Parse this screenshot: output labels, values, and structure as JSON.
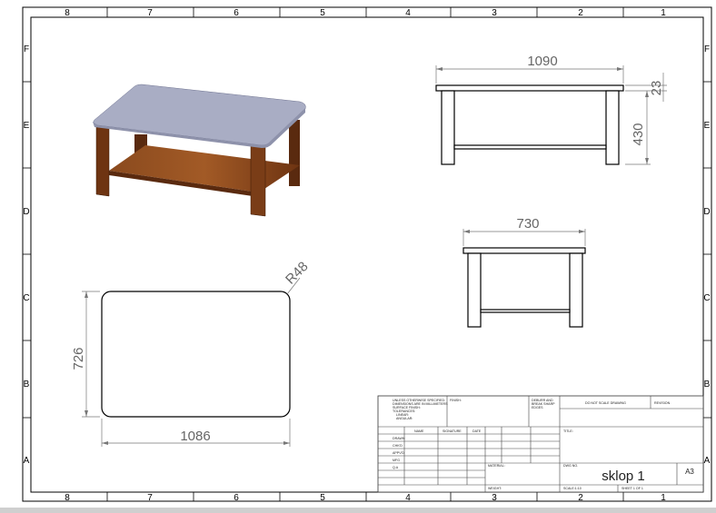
{
  "zones": {
    "columns": [
      "8",
      "7",
      "6",
      "5",
      "4",
      "3",
      "2",
      "1"
    ],
    "rows": [
      "F",
      "E",
      "D",
      "C",
      "B",
      "A"
    ]
  },
  "dimensions": {
    "front_length": "1090",
    "front_top_thickness": "23",
    "front_height": "430",
    "side_width": "730",
    "top_radius": "R48",
    "top_length": "1086",
    "top_width": "726"
  },
  "title_block": {
    "general_tolerances": [
      "UNLESS OTHERWISE SPECIFIED:",
      "DIMENSIONS ARE IN MILLIMETERS",
      "SURFACE FINISH:",
      "TOLERANCES:",
      "LINEAR:",
      "ANGULAR:"
    ],
    "finish_label": "FINISH:",
    "deburr_label": [
      "DEBURR AND",
      "BREAK SHARP",
      "EDGES"
    ],
    "do_not_scale": "DO NOT SCALE DRAWING",
    "revision_label": "REVISION",
    "col_headers": [
      "NAME",
      "SIGNATURE",
      "DATE"
    ],
    "rows": [
      "DRAWN",
      "CHK'D",
      "APPV'D",
      "MFG",
      "Q.A"
    ],
    "title_label": "TITLE:",
    "material_label": "MATERIAL:",
    "dwg_no_label": "DWG NO.",
    "dwg_no": "sklop 1",
    "sheet_size": "A3",
    "weight_label": "WEIGHT:",
    "scale_label": "SCALE:1:10",
    "sheet_label": "SHEET 1 OF 1"
  },
  "colors": {
    "table_top": "#a9adc4",
    "wood": "#7a3d17",
    "wood_dark": "#4a1f0b",
    "dimension_text": "#666666"
  }
}
